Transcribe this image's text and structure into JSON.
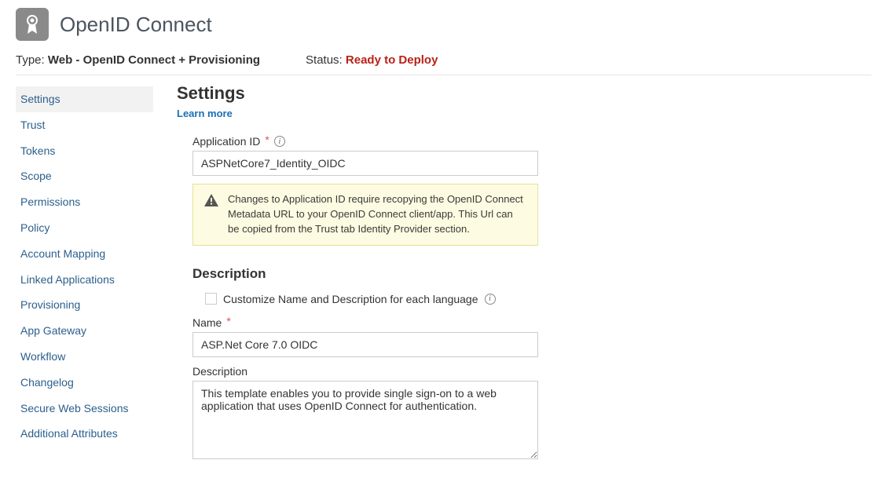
{
  "header": {
    "title": "OpenID Connect"
  },
  "meta": {
    "type_label": "Type:",
    "type_value": "Web - OpenID Connect + Provisioning",
    "status_label": "Status:",
    "status_value": "Ready to Deploy"
  },
  "sidebar": {
    "items": [
      {
        "label": "Settings",
        "active": true
      },
      {
        "label": "Trust"
      },
      {
        "label": "Tokens"
      },
      {
        "label": "Scope"
      },
      {
        "label": "Permissions"
      },
      {
        "label": "Policy"
      },
      {
        "label": "Account Mapping"
      },
      {
        "label": "Linked Applications"
      },
      {
        "label": "Provisioning"
      },
      {
        "label": "App Gateway"
      },
      {
        "label": "Workflow"
      },
      {
        "label": "Changelog"
      },
      {
        "label": "Secure Web Sessions"
      },
      {
        "label": "Additional Attributes"
      }
    ]
  },
  "content": {
    "section_title": "Settings",
    "learn_more": "Learn more",
    "app_id_label": "Application ID",
    "app_id_value": "ASPNetCore7_Identity_OIDC",
    "warn_text": "Changes to Application ID require recopying the OpenID Connect Metadata URL to your OpenID Connect client/app. This Url can be copied from the Trust tab Identity Provider section.",
    "description_heading": "Description",
    "customize_label": "Customize Name and Description for each language",
    "name_label": "Name",
    "name_value": "ASP.Net Core 7.0 OIDC",
    "description_label": "Description",
    "description_value": "This template enables you to provide single sign-on to a web application that uses OpenID Connect for authentication."
  }
}
